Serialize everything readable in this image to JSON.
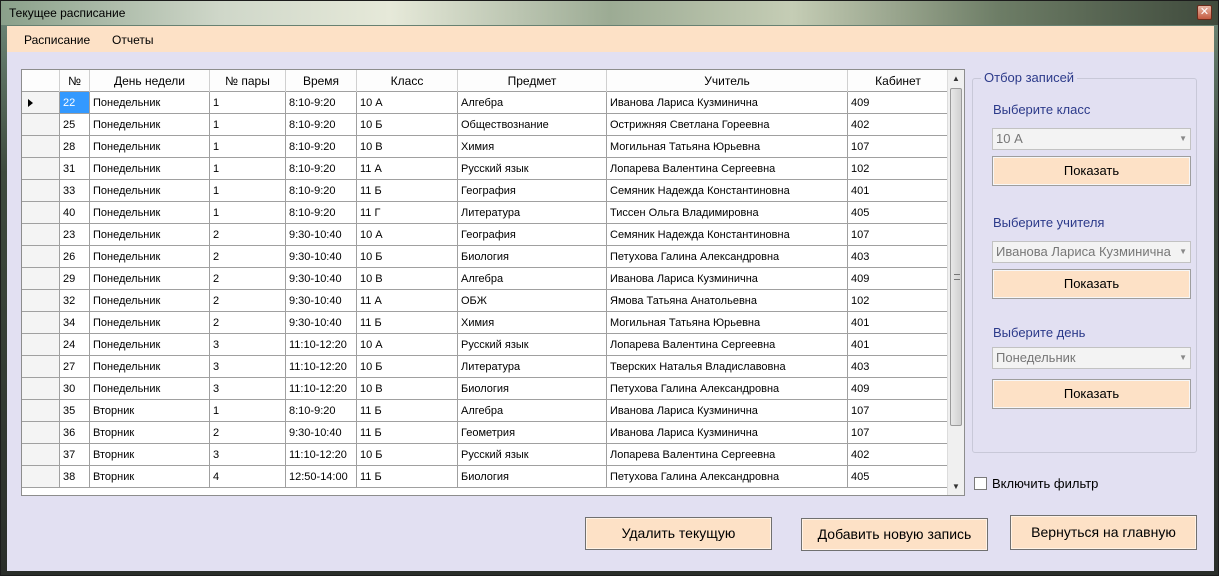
{
  "window": {
    "title": "Текущее расписание",
    "close_glyph": "✕"
  },
  "menu": [
    "Расписание",
    "Отчеты"
  ],
  "grid": {
    "columns": [
      "№",
      "День недели",
      "№ пары",
      "Время",
      "Класс",
      "Предмет",
      "Учитель",
      "Кабинет"
    ],
    "rows": [
      [
        "22",
        "Понедельник",
        "1",
        "8:10-9:20",
        "10 А",
        "Алгебра",
        "Иванова Лариса Кузминична",
        "409"
      ],
      [
        "25",
        "Понедельник",
        "1",
        "8:10-9:20",
        "10 Б",
        "Обществознание",
        "Острижняя Светлана Гореевна",
        "402"
      ],
      [
        "28",
        "Понедельник",
        "1",
        "8:10-9:20",
        "10 В",
        "Химия",
        "Могильная Татьяна Юрьевна",
        "107"
      ],
      [
        "31",
        "Понедельник",
        "1",
        "8:10-9:20",
        "11 А",
        "Русский язык",
        "Лопарева Валентина Сергеевна",
        "102"
      ],
      [
        "33",
        "Понедельник",
        "1",
        "8:10-9:20",
        "11 Б",
        "География",
        "Семяник Надежда Константиновна",
        "401"
      ],
      [
        "40",
        "Понедельник",
        "1",
        "8:10-9:20",
        "11 Г",
        "Литература",
        "Тиссен Ольга Владимировна",
        "405"
      ],
      [
        "23",
        "Понедельник",
        "2",
        "9:30-10:40",
        "10 А",
        "География",
        "Семяник Надежда Константиновна",
        "107"
      ],
      [
        "26",
        "Понедельник",
        "2",
        "9:30-10:40",
        "10 Б",
        "Биология",
        "Петухова Галина Александровна",
        "403"
      ],
      [
        "29",
        "Понедельник",
        "2",
        "9:30-10:40",
        "10 В",
        "Алгебра",
        "Иванова Лариса Кузминична",
        "409"
      ],
      [
        "32",
        "Понедельник",
        "2",
        "9:30-10:40",
        "11 А",
        "ОБЖ",
        "Ямова Татьяна Анатольевна",
        "102"
      ],
      [
        "34",
        "Понедельник",
        "2",
        "9:30-10:40",
        "11 Б",
        "Химия",
        "Могильная Татьяна Юрьевна",
        "401"
      ],
      [
        "24",
        "Понедельник",
        "3",
        "11:10-12:20",
        "10 А",
        "Русский язык",
        "Лопарева Валентина Сергеевна",
        "401"
      ],
      [
        "27",
        "Понедельник",
        "3",
        "11:10-12:20",
        "10 Б",
        "Литература",
        "Тверских Наталья Владиславовна",
        "403"
      ],
      [
        "30",
        "Понедельник",
        "3",
        "11:10-12:20",
        "10 В",
        "Биология",
        "Петухова Галина Александровна",
        "409"
      ],
      [
        "35",
        "Вторник",
        "1",
        "8:10-9:20",
        "11 Б",
        "Алгебра",
        "Иванова Лариса Кузминична",
        "107"
      ],
      [
        "36",
        "Вторник",
        "2",
        "9:30-10:40",
        "11 Б",
        "Геометрия",
        "Иванова Лариса Кузминична",
        "107"
      ],
      [
        "37",
        "Вторник",
        "3",
        "11:10-12:20",
        "10 Б",
        "Русский язык",
        "Лопарева Валентина Сергеевна",
        "402"
      ],
      [
        "38",
        "Вторник",
        "4",
        "12:50-14:00",
        "11 Б",
        "Биология",
        "Петухова Галина Александровна",
        "405"
      ]
    ],
    "selected_row": 0
  },
  "filter": {
    "legend": "Отбор записей",
    "class_label": "Выберите класс",
    "class_value": "10 А",
    "teacher_label": "Выберите учителя",
    "teacher_value": "Иванова Лариса Кузминична",
    "day_label": "Выберите день",
    "day_value": "Понедельник",
    "show_label": "Показать",
    "enable_filter_label": "Включить фильтр"
  },
  "actions": {
    "delete_label": "Удалить текущую",
    "add_label": "Добавить новую запись",
    "back_label": "Вернуться на главную"
  }
}
